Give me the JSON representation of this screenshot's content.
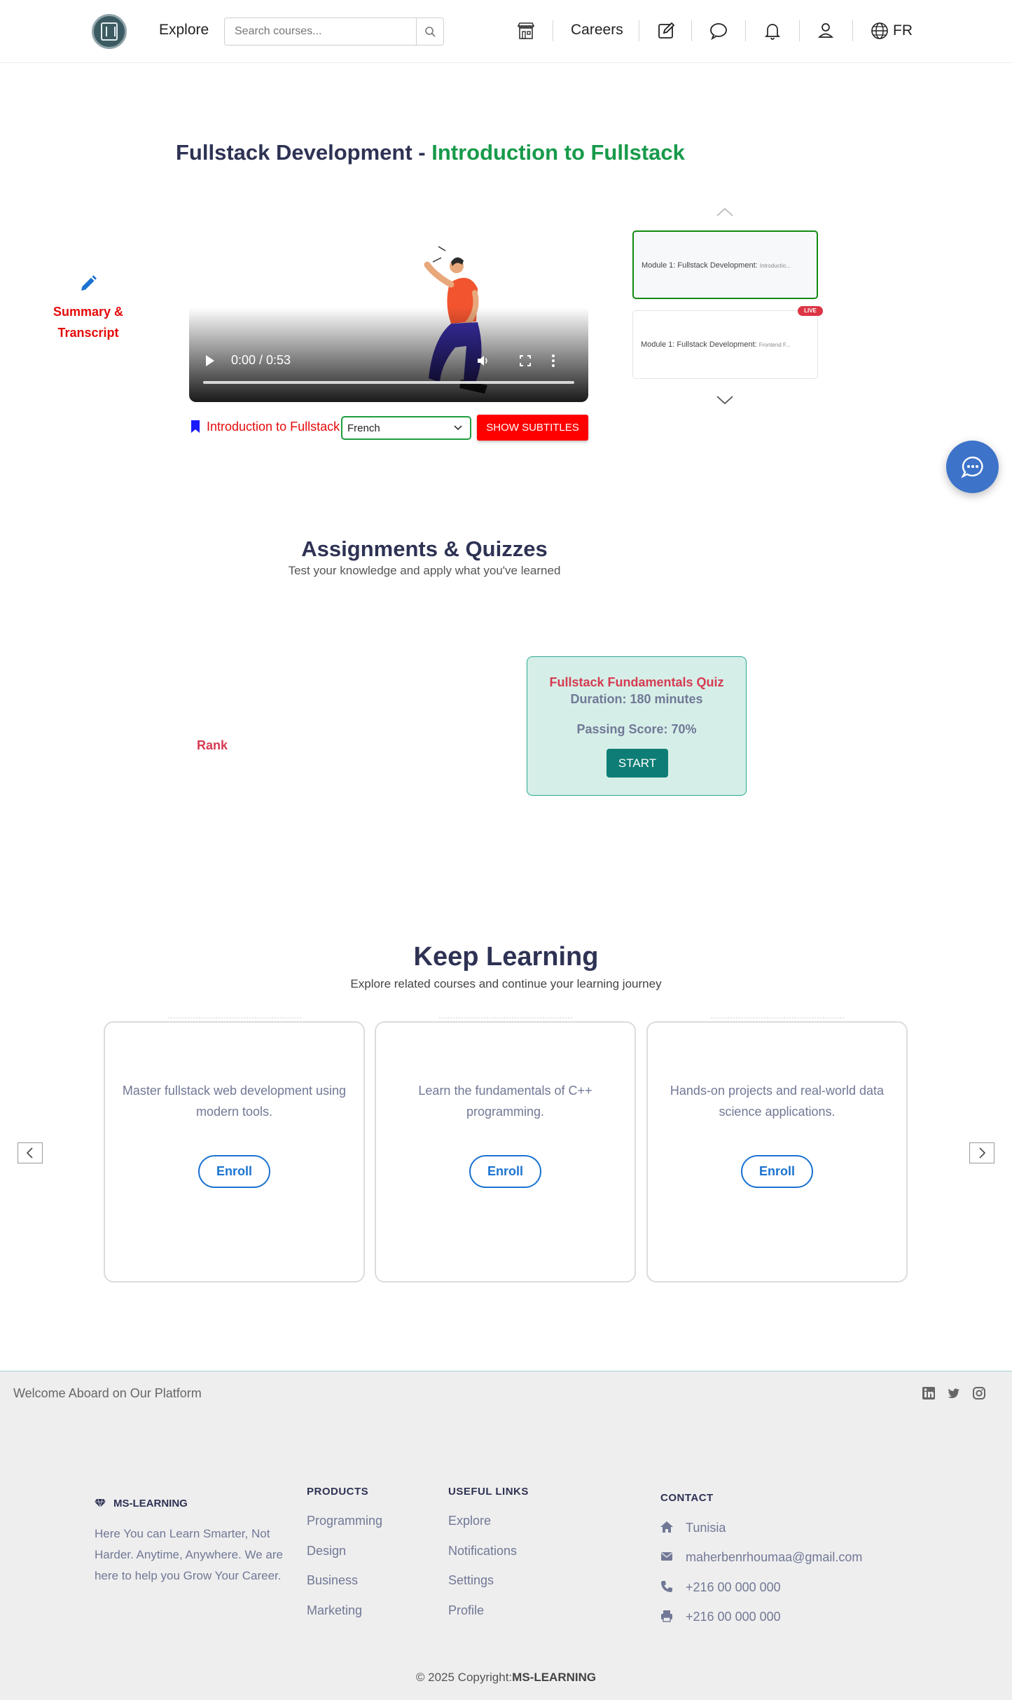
{
  "nav": {
    "explore": "Explore",
    "search_placeholder": "Search courses...",
    "careers": "Careers",
    "lang": "FR"
  },
  "course": {
    "title_prefix": "Fullstack Development - ",
    "title_highlight": "Introduction to Fullstack",
    "summary_line1": "Summary &",
    "summary_line2": "Transcript"
  },
  "video": {
    "time": "0:00 / 0:53"
  },
  "lesson": {
    "name": "Introduction to Fullstack",
    "language": "French",
    "show_subtitles": "SHOW SUBTITLES"
  },
  "modules": {
    "items": [
      {
        "label": "Module 1: Fullstack Development:",
        "sub": "Introductio..."
      },
      {
        "label": "Module 1: Fullstack Development:",
        "sub": "Frontend F...",
        "badge": "LIVE"
      }
    ]
  },
  "assignments": {
    "title": "Assignments & Quizzes",
    "subtitle": "Test your knowledge and apply what you've learned",
    "rank": "Rank",
    "quiz": {
      "title": "Fullstack Fundamentals Quiz",
      "duration": "Duration: 180 minutes",
      "passing": "Passing Score: 70%",
      "start": "START"
    }
  },
  "keep_learning": {
    "title": "Keep Learning",
    "subtitle": "Explore related courses and continue your learning journey",
    "courses": [
      {
        "desc": "Master fullstack web development using modern tools.",
        "enroll": "Enroll"
      },
      {
        "desc": "Learn the fundamentals of C++ programming.",
        "enroll": "Enroll"
      },
      {
        "desc": "Hands-on projects and real-world data science applications.",
        "enroll": "Enroll"
      }
    ]
  },
  "footer": {
    "welcome": "Welcome Aboard on Our Platform",
    "brand": "MS-LEARNING",
    "about": "Here You can Learn Smarter, Not Harder. Anytime, Anywhere. We are here to help you Grow Your Career.",
    "products_head": "PRODUCTS",
    "products": [
      "Programming",
      "Design",
      "Business",
      "Marketing"
    ],
    "links_head": "USEFUL LINKS",
    "links": [
      "Explore",
      "Notifications",
      "Settings",
      "Profile"
    ],
    "contact_head": "CONTACT",
    "contact": {
      "location": "Tunisia",
      "email": "maherbenrhoumaa@gmail.com",
      "phone": "+216 00 000 000",
      "fax": "+216 00 000 000"
    },
    "copyright_prefix": "© 2025 Copyright:",
    "copyright_brand": "MS-LEARNING"
  },
  "icons": {
    "nav": [
      "store-icon",
      "edit-icon",
      "chat-icon",
      "bell-icon",
      "user-icon",
      "globe-icon"
    ],
    "social": [
      "linkedin-icon",
      "twitter-icon",
      "instagram-icon"
    ]
  },
  "colors": {
    "accent_green": "#179a4a",
    "accent_red": "#e60a0a",
    "dark_title": "#2e3254",
    "quiz_bg": "#d5efe8",
    "quiz_button": "#0e7d75",
    "enroll_blue": "#1a73d0",
    "chat_fab": "#3d73c9"
  }
}
